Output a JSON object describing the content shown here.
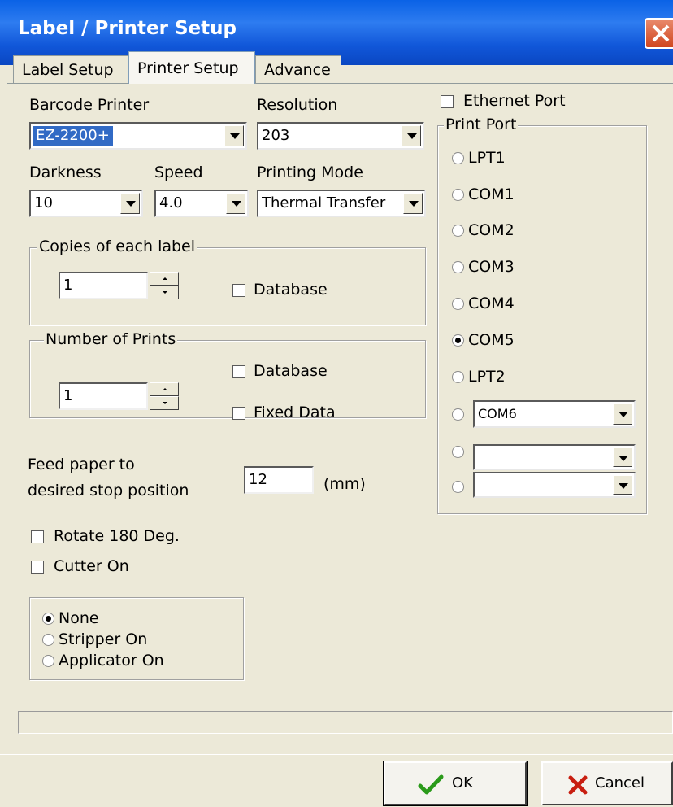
{
  "window": {
    "title": "Label / Printer Setup"
  },
  "tabs": [
    {
      "label": "Label Setup"
    },
    {
      "label": "Printer Setup"
    },
    {
      "label": "Advance"
    }
  ],
  "printer": {
    "barcode_printer_label": "Barcode Printer",
    "barcode_printer_value": "EZ-2200+",
    "resolution_label": "Resolution",
    "resolution_value": "203",
    "darkness_label": "Darkness",
    "darkness_value": "10",
    "speed_label": "Speed",
    "speed_value": "4.0",
    "printing_mode_label": "Printing Mode",
    "printing_mode_value": "Thermal Transfer"
  },
  "copies": {
    "legend": "Copies of each label",
    "value": "1",
    "database_label": "Database",
    "database_checked": false
  },
  "prints": {
    "legend": "Number of Prints",
    "value": "1",
    "database_label": "Database",
    "database_checked": false,
    "fixed_data_label": "Fixed Data",
    "fixed_data_checked": false
  },
  "feed": {
    "line1": "Feed paper to",
    "line2": "desired stop position",
    "value": "12",
    "unit": "(mm)"
  },
  "options": {
    "rotate_label": "Rotate 180 Deg.",
    "rotate_checked": false,
    "cutter_label": "Cutter On",
    "cutter_checked": false
  },
  "mode_group": {
    "items": [
      {
        "label": "None",
        "selected": true
      },
      {
        "label": "Stripper On",
        "selected": false
      },
      {
        "label": "Applicator On",
        "selected": false
      }
    ]
  },
  "ports": {
    "ethernet_label": "Ethernet Port",
    "ethernet_checked": false,
    "legend": "Print Port",
    "items": [
      {
        "label": "LPT1",
        "selected": false
      },
      {
        "label": "COM1",
        "selected": false
      },
      {
        "label": "COM2",
        "selected": false
      },
      {
        "label": "COM3",
        "selected": false
      },
      {
        "label": "COM4",
        "selected": false
      },
      {
        "label": "COM5",
        "selected": true
      },
      {
        "label": "LPT2",
        "selected": false
      }
    ],
    "custom_port_1_value": "COM6",
    "custom_port_2_value": "",
    "custom_port_3_value": ""
  },
  "buttons": {
    "ok_label": "OK",
    "cancel_label": "Cancel"
  },
  "colors": {
    "titlebar": "#0a62e6",
    "face": "#ece9d8",
    "selection": "#316ac5"
  }
}
